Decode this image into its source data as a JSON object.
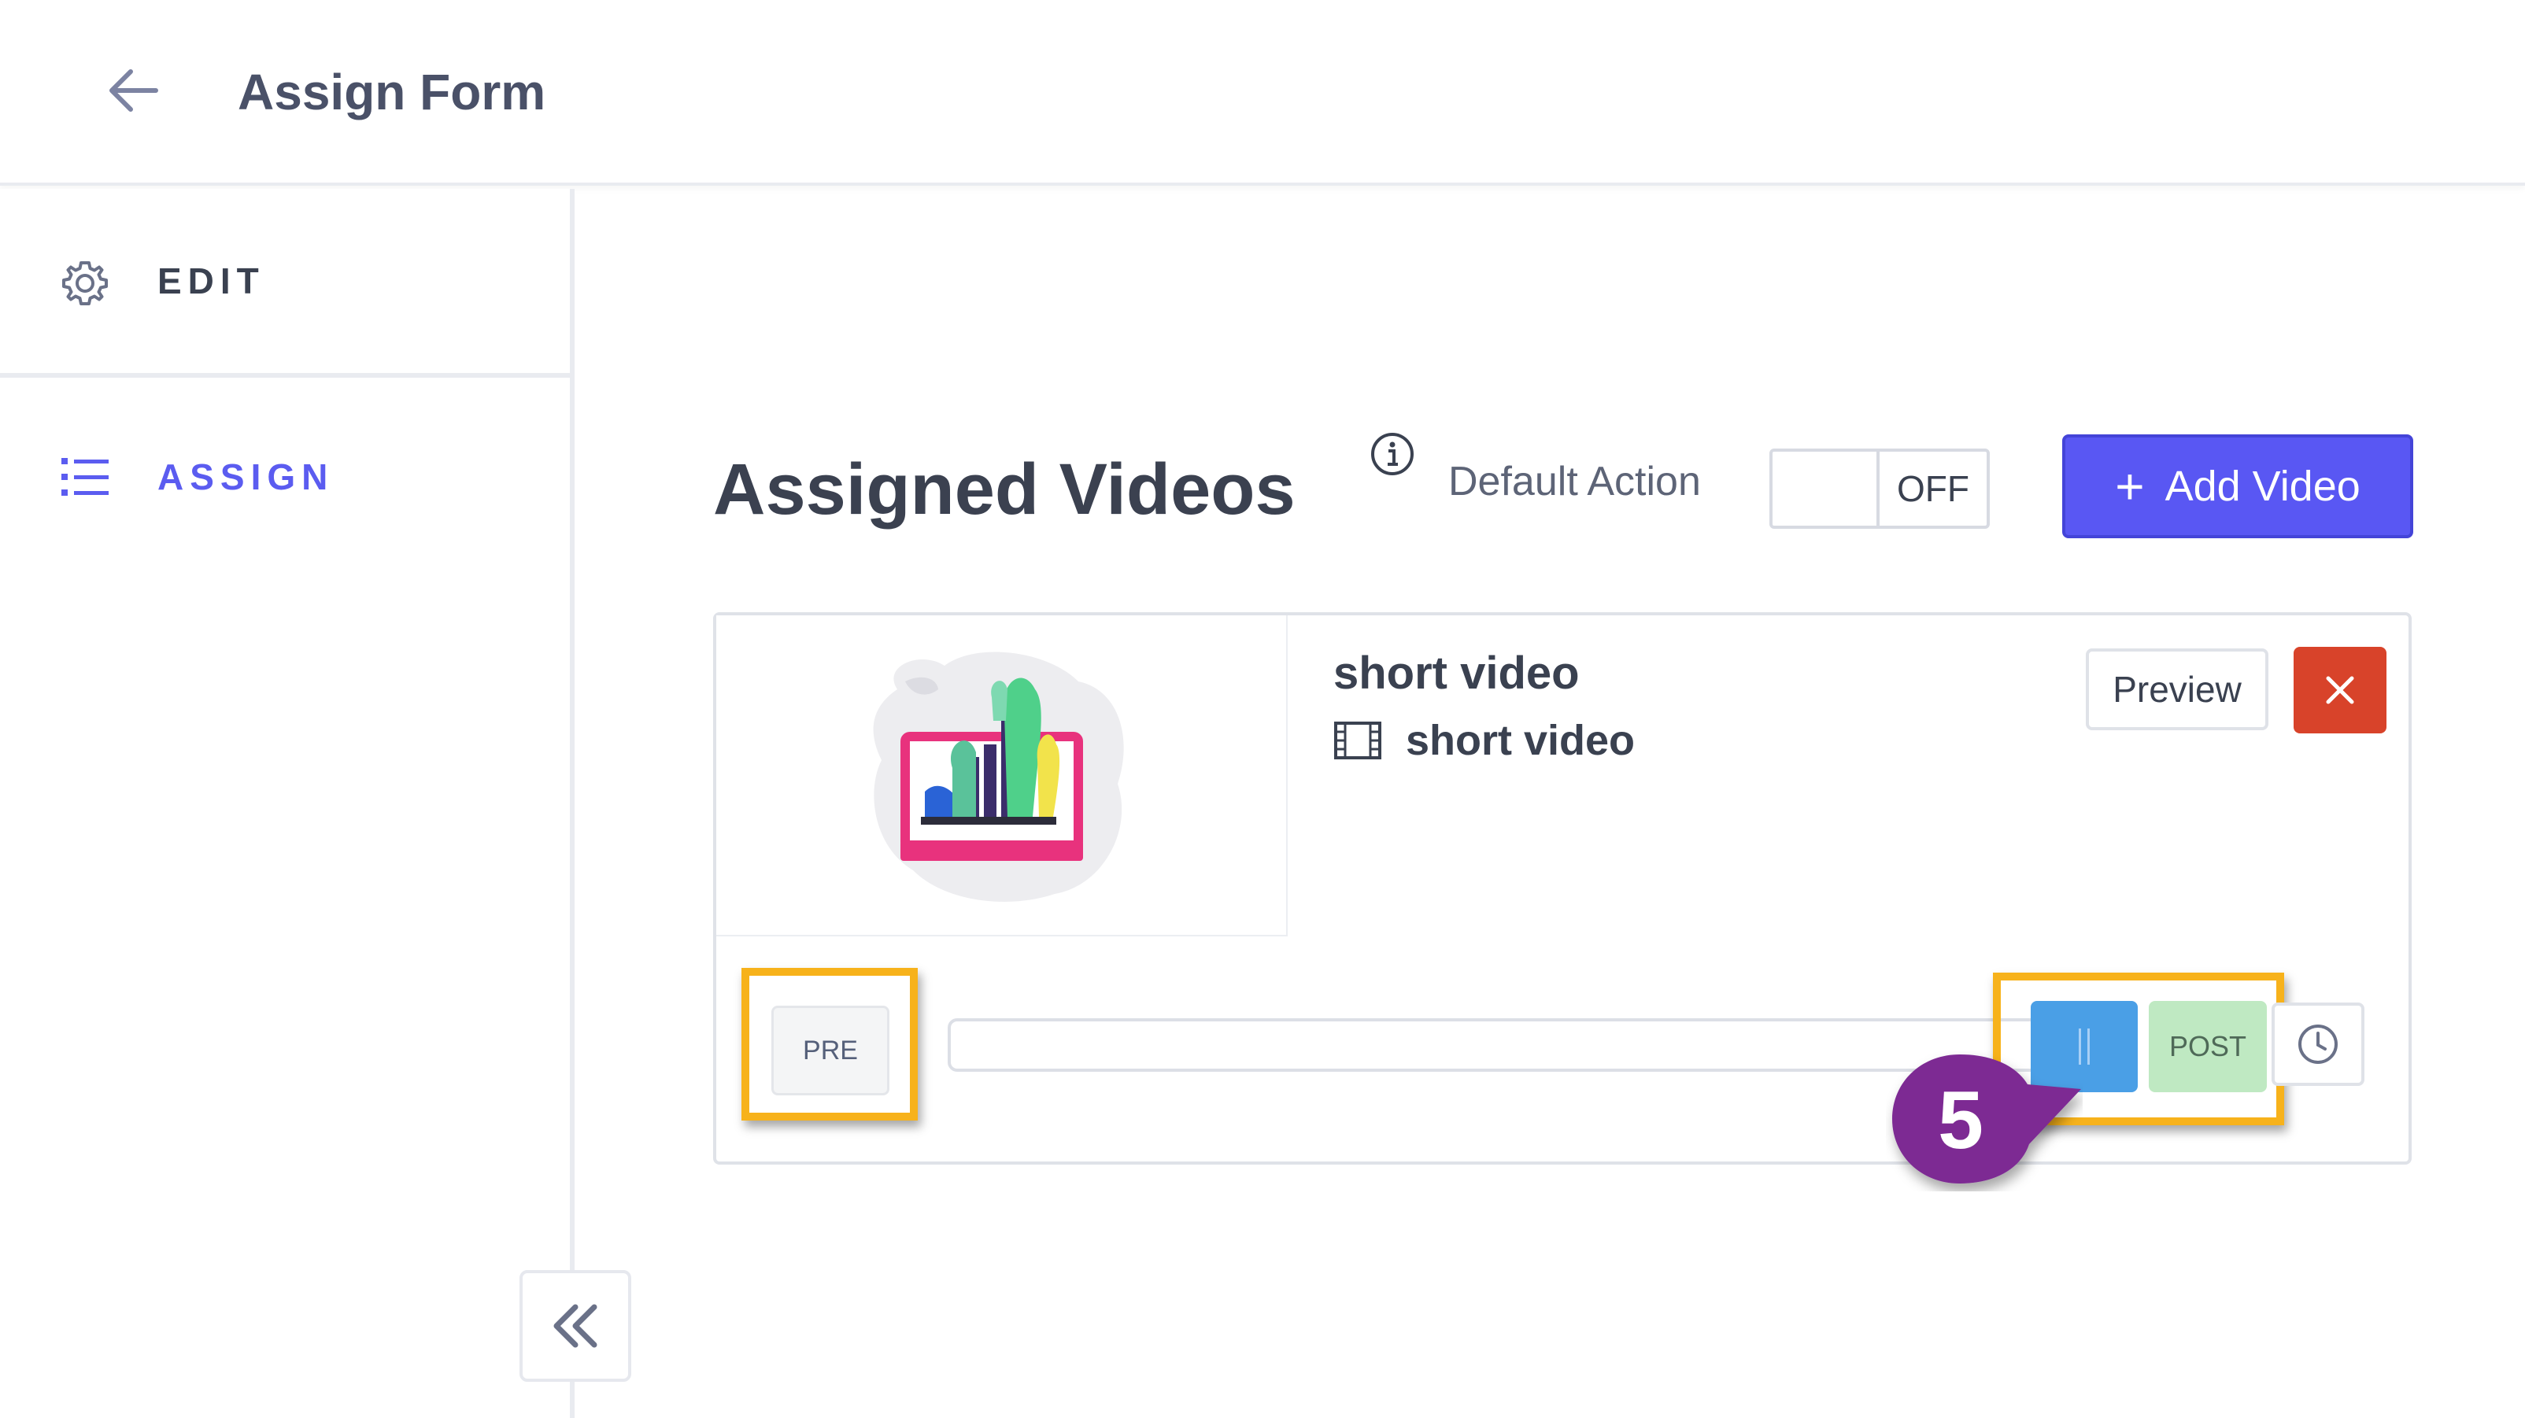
{
  "header": {
    "title": "Assign Form"
  },
  "sidebar": {
    "items": [
      {
        "label": "EDIT",
        "icon": "gear-icon",
        "active": false
      },
      {
        "label": "ASSIGN",
        "icon": "list-icon",
        "active": true
      }
    ]
  },
  "main": {
    "title": "Assigned Videos",
    "default_action_label": "Default Action",
    "toggle_state": "OFF",
    "add_video_label": "Add Video",
    "video": {
      "title": "short video",
      "file_name": "short video",
      "preview_label": "Preview",
      "pre_label": "PRE",
      "post_label": "POST"
    }
  },
  "annotation": {
    "step_number": "5"
  },
  "colors": {
    "accent": "#5957f3",
    "danger": "#d8432a",
    "highlight": "#f7b21b",
    "callout": "#7d2a93",
    "handle": "#4a9fe6",
    "post": "#bfe9c2"
  }
}
